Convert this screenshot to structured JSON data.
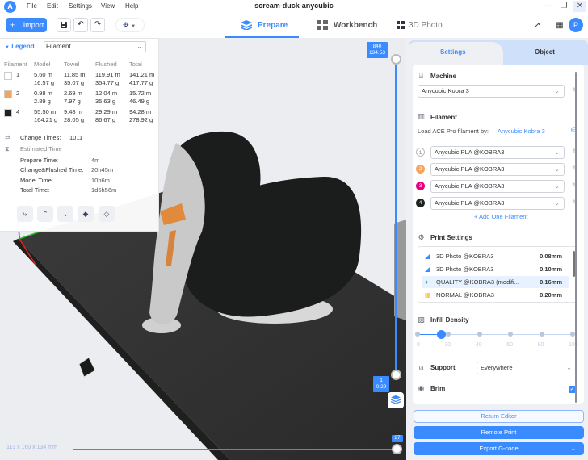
{
  "app": {
    "title": "scream-duck-anycubic",
    "logo_letter": "A",
    "menu": [
      "File",
      "Edit",
      "Settings",
      "View",
      "Help"
    ],
    "window_controls": {
      "minimize": "—",
      "restore": "❐",
      "close": "✕"
    }
  },
  "toolbar": {
    "import_label": "Import",
    "import_icon": "+",
    "tabs": [
      {
        "label": "Prepare",
        "active": true
      },
      {
        "label": "Workbench",
        "active": false
      },
      {
        "label": "3D Photo",
        "active": false
      }
    ],
    "avatar_letter": "P"
  },
  "legend": {
    "title": "Legend",
    "mode": "Filament",
    "columns": [
      "Filament",
      "Model",
      "Towel",
      "Flushed",
      "Total"
    ],
    "rows": [
      {
        "id": "1",
        "color": "#ffffff",
        "model_m": "5.60 m",
        "model_g": "16.57 g",
        "towel_m": "11.85 m",
        "towel_g": "35.07 g",
        "flushed_m": "119.91 m",
        "flushed_g": "354.77 g",
        "total_m": "141.21 m",
        "total_g": "417.77 g"
      },
      {
        "id": "2",
        "color": "#f7a35c",
        "model_m": "0.98 m",
        "model_g": "2.89 g",
        "towel_m": "2.69 m",
        "towel_g": "7.97 g",
        "flushed_m": "12.04 m",
        "flushed_g": "35.63 g",
        "total_m": "15.72 m",
        "total_g": "46.49 g"
      },
      {
        "id": "4",
        "color": "#1e221f",
        "model_m": "55.50 m",
        "model_g": "164.21 g",
        "towel_m": "9.48 m",
        "towel_g": "28.05 g",
        "flushed_m": "29.29 m",
        "flushed_g": "86.67 g",
        "total_m": "94.28 m",
        "total_g": "278.92 g"
      }
    ],
    "change_times_label": "Change Times:",
    "change_times": "1011",
    "estimated_time_label": "Estimated Time",
    "times": [
      {
        "label": "Prepare Time:",
        "value": "4m"
      },
      {
        "label": "Change&Flushed Time:",
        "value": "20h45m"
      },
      {
        "label": "Model Time:",
        "value": "10h6m"
      },
      {
        "label": "Total Time:",
        "value": "1d6h56m"
      }
    ]
  },
  "viewport": {
    "dimensions": "113 x 160 x 134 mm",
    "layer_top": {
      "layer": "840",
      "height": "134.53"
    },
    "layer_bottom": {
      "layer": "1",
      "height": "0.29"
    },
    "move_value": "27"
  },
  "panel": {
    "tabs": [
      {
        "label": "Settings",
        "active": true
      },
      {
        "label": "Object",
        "active": false
      }
    ],
    "machine": {
      "title": "Machine",
      "value": "Anycubic Kobra 3"
    },
    "filament": {
      "title": "Filament",
      "load_label": "Load ACE Pro filament by:",
      "load_link": "Anycubic Kobra 3",
      "slots": [
        {
          "num": "1",
          "color": "#ffffff",
          "value": "Anycubic PLA @KOBRA3"
        },
        {
          "num": "2",
          "color": "#f7a35c",
          "value": "Anycubic PLA @KOBRA3"
        },
        {
          "num": "3",
          "color": "#e6007e",
          "value": "Anycubic PLA @KOBRA3"
        },
        {
          "num": "4",
          "color": "#1e221f",
          "value": "Anycubic PLA @KOBRA3"
        }
      ],
      "add_label": "+ Add One Filament"
    },
    "print_settings": {
      "title": "Print Settings",
      "items": [
        {
          "name": "3D Photo @KOBRA3",
          "value": "0.08mm",
          "icon": "photo",
          "selected": false
        },
        {
          "name": "3D Photo @KOBRA3",
          "value": "0.10mm",
          "icon": "photo",
          "selected": false
        },
        {
          "name": "QUALITY @KOBRA3 (modifi...",
          "value": "0.16mm",
          "icon": "quality",
          "selected": true
        },
        {
          "name": "NORMAL @KOBRA3",
          "value": "0.20mm",
          "icon": "normal",
          "selected": false
        }
      ]
    },
    "infill": {
      "title": "Infill Density",
      "value_percent": 15,
      "ticks": [
        "0",
        "20",
        "40",
        "60",
        "80",
        "100"
      ]
    },
    "support": {
      "title": "Support",
      "value": "Everywhere"
    },
    "brim": {
      "title": "Brim",
      "checked": true
    },
    "buttons": {
      "return_editor": "Return Editor",
      "remote_print": "Remote Print",
      "export": "Export G-code"
    }
  }
}
